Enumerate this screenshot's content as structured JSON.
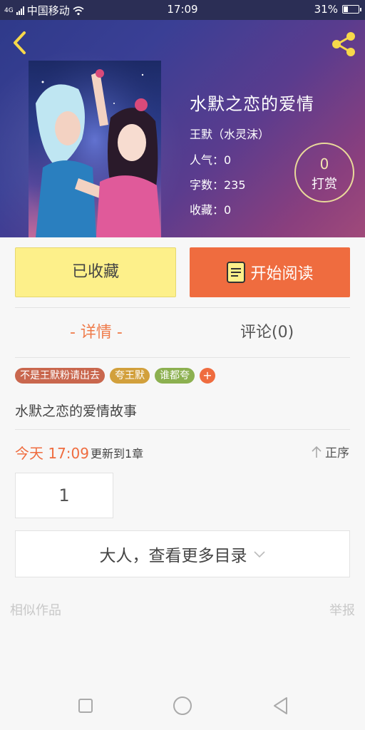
{
  "status_bar": {
    "network": "4G",
    "carrier": "中国移动",
    "time": "17:09",
    "battery": "31%",
    "battery_level": 0.31
  },
  "book": {
    "title": "水默之恋的爱情",
    "author": "王默（水灵沫）",
    "popularity": "人气：0",
    "word_count": "字数：235",
    "favorites": "收藏：0",
    "tip_count": "0",
    "tip_label": "打赏"
  },
  "actions": {
    "collected_label": "已收藏",
    "read_label": "开始阅读"
  },
  "tabs": {
    "details": "- 详情 -",
    "comments": "评论(0)"
  },
  "tags": [
    {
      "label": "不是王默粉请出去",
      "color": "#c9674e"
    },
    {
      "label": "夸王默",
      "color": "#d2a03c"
    },
    {
      "label": "谁都夸",
      "color": "#8cb050"
    }
  ],
  "tag_add_label": "+",
  "description": "水默之恋的爱情故事",
  "update": {
    "time": "今天 17:09",
    "text": "更新到1章",
    "sort_label": "正序"
  },
  "chapter_number": "1",
  "more_toc_label": "大人，查看更多目录",
  "similar_works_label": "相似作品",
  "report_label": "举报",
  "colors": {
    "accent_orange": "#ef6c3f",
    "collected_yellow": "#fdf08a",
    "header_start": "#2f3a8a",
    "header_end": "#a04a7a"
  },
  "icons": {
    "back": "chevron-left-icon",
    "share": "share-icon",
    "book": "book-icon",
    "sort": "arrow-up-icon",
    "toc_expand": "chevron-down-icon",
    "nav_recent": "square-icon",
    "nav_home": "circle-icon",
    "nav_back": "triangle-back-icon"
  }
}
